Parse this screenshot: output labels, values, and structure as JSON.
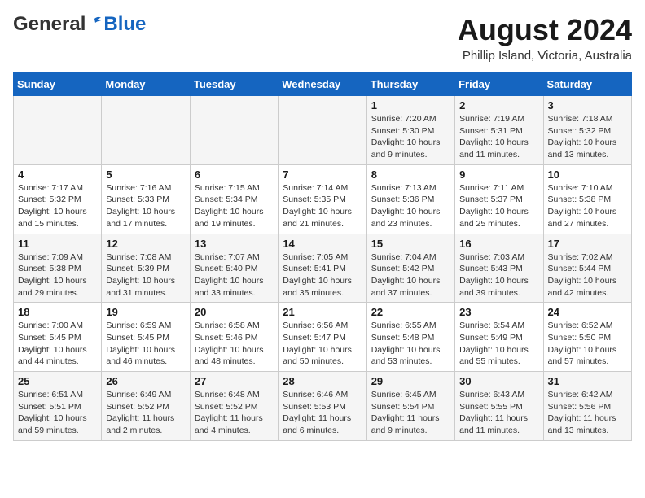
{
  "header": {
    "logo_general": "General",
    "logo_blue": "Blue",
    "month_title": "August 2024",
    "location": "Phillip Island, Victoria, Australia"
  },
  "weekdays": [
    "Sunday",
    "Monday",
    "Tuesday",
    "Wednesday",
    "Thursday",
    "Friday",
    "Saturday"
  ],
  "weeks": [
    [
      {
        "day": "",
        "info": ""
      },
      {
        "day": "",
        "info": ""
      },
      {
        "day": "",
        "info": ""
      },
      {
        "day": "",
        "info": ""
      },
      {
        "day": "1",
        "info": "Sunrise: 7:20 AM\nSunset: 5:30 PM\nDaylight: 10 hours\nand 9 minutes."
      },
      {
        "day": "2",
        "info": "Sunrise: 7:19 AM\nSunset: 5:31 PM\nDaylight: 10 hours\nand 11 minutes."
      },
      {
        "day": "3",
        "info": "Sunrise: 7:18 AM\nSunset: 5:32 PM\nDaylight: 10 hours\nand 13 minutes."
      }
    ],
    [
      {
        "day": "4",
        "info": "Sunrise: 7:17 AM\nSunset: 5:32 PM\nDaylight: 10 hours\nand 15 minutes."
      },
      {
        "day": "5",
        "info": "Sunrise: 7:16 AM\nSunset: 5:33 PM\nDaylight: 10 hours\nand 17 minutes."
      },
      {
        "day": "6",
        "info": "Sunrise: 7:15 AM\nSunset: 5:34 PM\nDaylight: 10 hours\nand 19 minutes."
      },
      {
        "day": "7",
        "info": "Sunrise: 7:14 AM\nSunset: 5:35 PM\nDaylight: 10 hours\nand 21 minutes."
      },
      {
        "day": "8",
        "info": "Sunrise: 7:13 AM\nSunset: 5:36 PM\nDaylight: 10 hours\nand 23 minutes."
      },
      {
        "day": "9",
        "info": "Sunrise: 7:11 AM\nSunset: 5:37 PM\nDaylight: 10 hours\nand 25 minutes."
      },
      {
        "day": "10",
        "info": "Sunrise: 7:10 AM\nSunset: 5:38 PM\nDaylight: 10 hours\nand 27 minutes."
      }
    ],
    [
      {
        "day": "11",
        "info": "Sunrise: 7:09 AM\nSunset: 5:38 PM\nDaylight: 10 hours\nand 29 minutes."
      },
      {
        "day": "12",
        "info": "Sunrise: 7:08 AM\nSunset: 5:39 PM\nDaylight: 10 hours\nand 31 minutes."
      },
      {
        "day": "13",
        "info": "Sunrise: 7:07 AM\nSunset: 5:40 PM\nDaylight: 10 hours\nand 33 minutes."
      },
      {
        "day": "14",
        "info": "Sunrise: 7:05 AM\nSunset: 5:41 PM\nDaylight: 10 hours\nand 35 minutes."
      },
      {
        "day": "15",
        "info": "Sunrise: 7:04 AM\nSunset: 5:42 PM\nDaylight: 10 hours\nand 37 minutes."
      },
      {
        "day": "16",
        "info": "Sunrise: 7:03 AM\nSunset: 5:43 PM\nDaylight: 10 hours\nand 39 minutes."
      },
      {
        "day": "17",
        "info": "Sunrise: 7:02 AM\nSunset: 5:44 PM\nDaylight: 10 hours\nand 42 minutes."
      }
    ],
    [
      {
        "day": "18",
        "info": "Sunrise: 7:00 AM\nSunset: 5:45 PM\nDaylight: 10 hours\nand 44 minutes."
      },
      {
        "day": "19",
        "info": "Sunrise: 6:59 AM\nSunset: 5:45 PM\nDaylight: 10 hours\nand 46 minutes."
      },
      {
        "day": "20",
        "info": "Sunrise: 6:58 AM\nSunset: 5:46 PM\nDaylight: 10 hours\nand 48 minutes."
      },
      {
        "day": "21",
        "info": "Sunrise: 6:56 AM\nSunset: 5:47 PM\nDaylight: 10 hours\nand 50 minutes."
      },
      {
        "day": "22",
        "info": "Sunrise: 6:55 AM\nSunset: 5:48 PM\nDaylight: 10 hours\nand 53 minutes."
      },
      {
        "day": "23",
        "info": "Sunrise: 6:54 AM\nSunset: 5:49 PM\nDaylight: 10 hours\nand 55 minutes."
      },
      {
        "day": "24",
        "info": "Sunrise: 6:52 AM\nSunset: 5:50 PM\nDaylight: 10 hours\nand 57 minutes."
      }
    ],
    [
      {
        "day": "25",
        "info": "Sunrise: 6:51 AM\nSunset: 5:51 PM\nDaylight: 10 hours\nand 59 minutes."
      },
      {
        "day": "26",
        "info": "Sunrise: 6:49 AM\nSunset: 5:52 PM\nDaylight: 11 hours\nand 2 minutes."
      },
      {
        "day": "27",
        "info": "Sunrise: 6:48 AM\nSunset: 5:52 PM\nDaylight: 11 hours\nand 4 minutes."
      },
      {
        "day": "28",
        "info": "Sunrise: 6:46 AM\nSunset: 5:53 PM\nDaylight: 11 hours\nand 6 minutes."
      },
      {
        "day": "29",
        "info": "Sunrise: 6:45 AM\nSunset: 5:54 PM\nDaylight: 11 hours\nand 9 minutes."
      },
      {
        "day": "30",
        "info": "Sunrise: 6:43 AM\nSunset: 5:55 PM\nDaylight: 11 hours\nand 11 minutes."
      },
      {
        "day": "31",
        "info": "Sunrise: 6:42 AM\nSunset: 5:56 PM\nDaylight: 11 hours\nand 13 minutes."
      }
    ]
  ]
}
